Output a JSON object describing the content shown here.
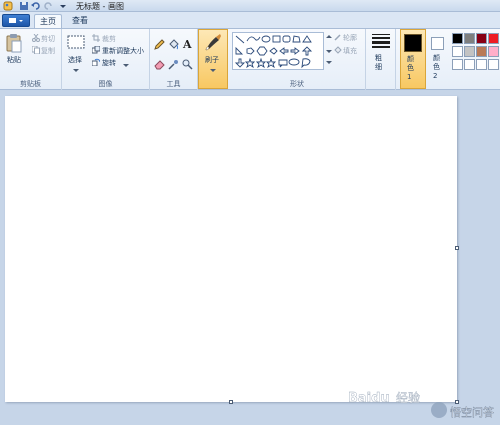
{
  "window": {
    "title": "无标题 - 画图"
  },
  "tabs": [
    {
      "label": "主页",
      "active": true
    },
    {
      "label": "查看",
      "active": false
    }
  ],
  "ribbon": {
    "clipboard": {
      "label": "剪贴板",
      "paste": "粘贴",
      "cut": "剪切",
      "copy": "复制"
    },
    "image": {
      "label": "图像",
      "select": "选择",
      "crop": "裁剪",
      "resize": "重新调整大小",
      "rotate": "旋转"
    },
    "tools": {
      "label": "工具"
    },
    "brushes": {
      "label": "刷子"
    },
    "shapes": {
      "label": "形状",
      "outline": "轮廓",
      "fill": "填充"
    },
    "size": {
      "label": "粗细"
    },
    "color1": {
      "label": "颜色 1",
      "color": "#000000"
    },
    "color2": {
      "label": "颜色 2",
      "color": "#ffffff"
    },
    "palette": [
      "#000000",
      "#7f7f7f",
      "#880015",
      "#ed1c24",
      "#ffffff",
      "#c3c3c3",
      "#b97a57",
      "#ffaec9",
      "#ffffff",
      "#ffffff",
      "#ffffff",
      "#ffffff"
    ]
  },
  "watermark": {
    "text": "Baidu 经验 / 悟空问答"
  }
}
